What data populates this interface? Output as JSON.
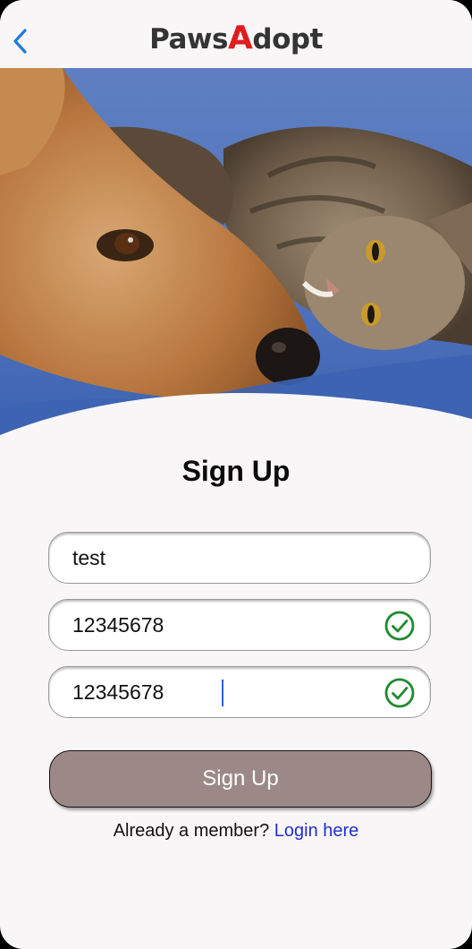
{
  "header": {
    "brand_part1": "Paws",
    "brand_accent": "A",
    "brand_part2": "dopt",
    "back_icon": "chevron-left-icon"
  },
  "hero": {
    "image": "dog-and-cat-photo"
  },
  "form": {
    "title": "Sign Up",
    "username_value": "test",
    "password_value": "12345678",
    "confirm_value": "12345678",
    "valid_icon": "check-circle-icon",
    "submit_label": "Sign Up"
  },
  "footer": {
    "prompt": "Already a member?",
    "link": "Login here"
  },
  "colors": {
    "accent_red": "#e01c1c",
    "button_bg": "#9c8987",
    "link_blue": "#1f30c9",
    "check_green": "#1f8a2e",
    "back_blue": "#1f7ae0"
  }
}
